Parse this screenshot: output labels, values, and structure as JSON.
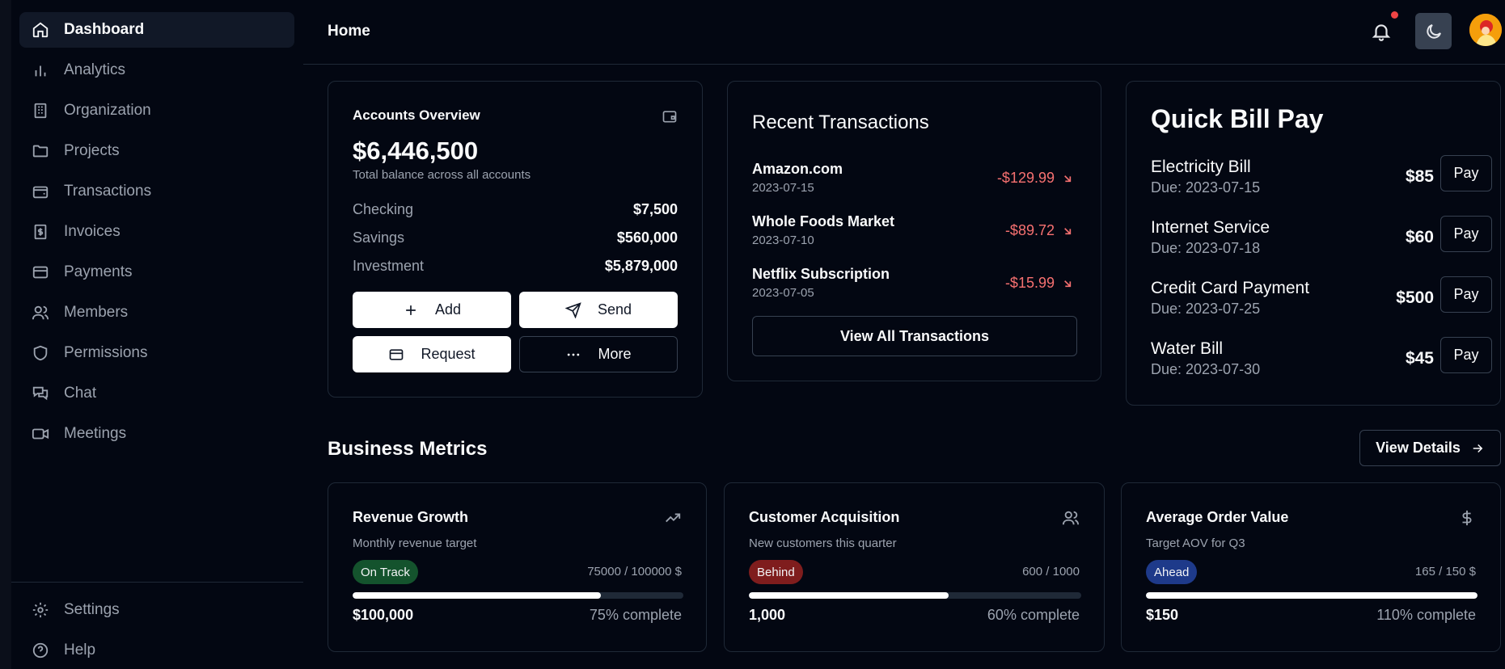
{
  "sidebar": {
    "items": [
      {
        "label": "Dashboard",
        "icon": "home-icon"
      },
      {
        "label": "Analytics",
        "icon": "bar-chart-icon"
      },
      {
        "label": "Organization",
        "icon": "building-icon"
      },
      {
        "label": "Projects",
        "icon": "folder-icon"
      },
      {
        "label": "Transactions",
        "icon": "wallet-icon"
      },
      {
        "label": "Invoices",
        "icon": "receipt-icon"
      },
      {
        "label": "Payments",
        "icon": "credit-card-icon"
      },
      {
        "label": "Members",
        "icon": "users-icon"
      },
      {
        "label": "Permissions",
        "icon": "shield-icon"
      },
      {
        "label": "Chat",
        "icon": "chat-icon"
      },
      {
        "label": "Meetings",
        "icon": "video-icon"
      }
    ],
    "bottom": [
      {
        "label": "Settings",
        "icon": "gear-icon"
      },
      {
        "label": "Help",
        "icon": "help-circle-icon"
      }
    ]
  },
  "header": {
    "title": "Home"
  },
  "accounts": {
    "title": "Accounts Overview",
    "total": "$6,446,500",
    "subtitle": "Total balance across all accounts",
    "rows": [
      {
        "label": "Checking",
        "value": "$7,500"
      },
      {
        "label": "Savings",
        "value": "$560,000"
      },
      {
        "label": "Investment",
        "value": "$5,879,000"
      }
    ],
    "buttons": {
      "add": "Add",
      "send": "Send",
      "request": "Request",
      "more": "More"
    }
  },
  "transactions": {
    "title": "Recent Transactions",
    "items": [
      {
        "name": "Amazon.com",
        "date": "2023-07-15",
        "amount": "-$129.99"
      },
      {
        "name": "Whole Foods Market",
        "date": "2023-07-10",
        "amount": "-$89.72"
      },
      {
        "name": "Netflix Subscription",
        "date": "2023-07-05",
        "amount": "-$15.99"
      }
    ],
    "view_all": "View All Transactions"
  },
  "bills": {
    "title": "Quick Bill Pay",
    "pay_label": "Pay",
    "items": [
      {
        "name": "Electricity Bill",
        "due": "Due: 2023-07-15",
        "amount": "$85"
      },
      {
        "name": "Internet Service",
        "due": "Due: 2023-07-18",
        "amount": "$60"
      },
      {
        "name": "Credit Card Payment",
        "due": "Due: 2023-07-25",
        "amount": "$500"
      },
      {
        "name": "Water Bill",
        "due": "Due: 2023-07-30",
        "amount": "$45"
      }
    ]
  },
  "metrics": {
    "title": "Business Metrics",
    "view_details": "View Details",
    "cards": [
      {
        "title": "Revenue Growth",
        "desc": "Monthly revenue target",
        "status": "On Track",
        "status_color": "#14532d",
        "progress_text": "75000 / 100000 $",
        "progress": 0.75,
        "target": "$100,000",
        "percent": "75% complete",
        "icon": "trending-up-icon"
      },
      {
        "title": "Customer Acquisition",
        "desc": "New customers this quarter",
        "status": "Behind",
        "status_color": "#7f1d1d",
        "progress_text": "600 / 1000",
        "progress": 0.6,
        "target": "1,000",
        "percent": "60% complete",
        "icon": "users-icon"
      },
      {
        "title": "Average Order Value",
        "desc": "Target AOV for Q3",
        "status": "Ahead",
        "status_color": "#1e3a8a",
        "progress_text": "165 / 150 $",
        "progress": 1.0,
        "target": "$150",
        "percent": "110% complete",
        "icon": "dollar-icon"
      }
    ]
  }
}
